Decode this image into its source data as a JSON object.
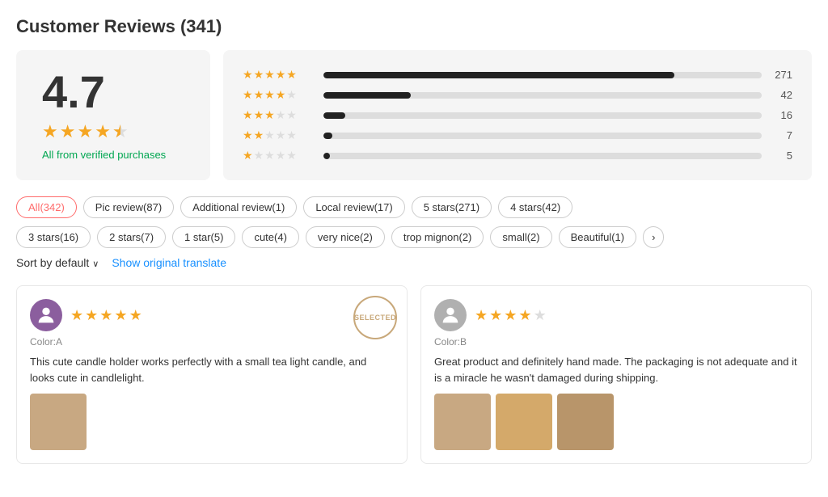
{
  "page": {
    "title": "Customer Reviews (341)"
  },
  "rating": {
    "score": "4.7",
    "verified": "All from verified purchases",
    "stars": [
      "full",
      "full",
      "full",
      "full",
      "half"
    ],
    "bars": [
      {
        "stars": [
          true,
          true,
          true,
          true,
          true
        ],
        "pct": 80,
        "count": "271"
      },
      {
        "stars": [
          true,
          true,
          true,
          true,
          false
        ],
        "pct": 20,
        "count": "42"
      },
      {
        "stars": [
          true,
          true,
          true,
          false,
          false
        ],
        "pct": 5,
        "count": "16"
      },
      {
        "stars": [
          true,
          true,
          false,
          false,
          false
        ],
        "pct": 2,
        "count": "7"
      },
      {
        "stars": [
          true,
          false,
          false,
          false,
          false
        ],
        "pct": 1.5,
        "count": "5"
      }
    ]
  },
  "filters": [
    {
      "label": "All(342)",
      "active": true
    },
    {
      "label": "Pic review(87)",
      "active": false
    },
    {
      "label": "Additional review(1)",
      "active": false
    },
    {
      "label": "Local review(17)",
      "active": false
    },
    {
      "label": "5 stars(271)",
      "active": false
    },
    {
      "label": "4 stars(42)",
      "active": false
    },
    {
      "label": "3 stars(16)",
      "active": false
    },
    {
      "label": "2 stars(7)",
      "active": false
    },
    {
      "label": "1 star(5)",
      "active": false
    },
    {
      "label": "cute(4)",
      "active": false
    },
    {
      "label": "very nice(2)",
      "active": false
    },
    {
      "label": "trop mignon(2)",
      "active": false
    },
    {
      "label": "small(2)",
      "active": false
    },
    {
      "label": "Beautiful(1)",
      "active": false
    }
  ],
  "sort": {
    "label": "Sort by default",
    "translate_label": "Show original translate"
  },
  "reviews": [
    {
      "id": 1,
      "stars": 5,
      "color": "Color:A",
      "text": "This cute candle holder works perfectly with a small tea light candle, and looks cute in candlelight.",
      "selected": true,
      "selected_text": "SELECTED",
      "has_images": true
    },
    {
      "id": 2,
      "stars": 4,
      "color": "Color:B",
      "text": "Great product and definitely hand made. The packaging is not adequate and it is a miracle he wasn't damaged during shipping.",
      "selected": false,
      "has_images": true
    }
  ]
}
